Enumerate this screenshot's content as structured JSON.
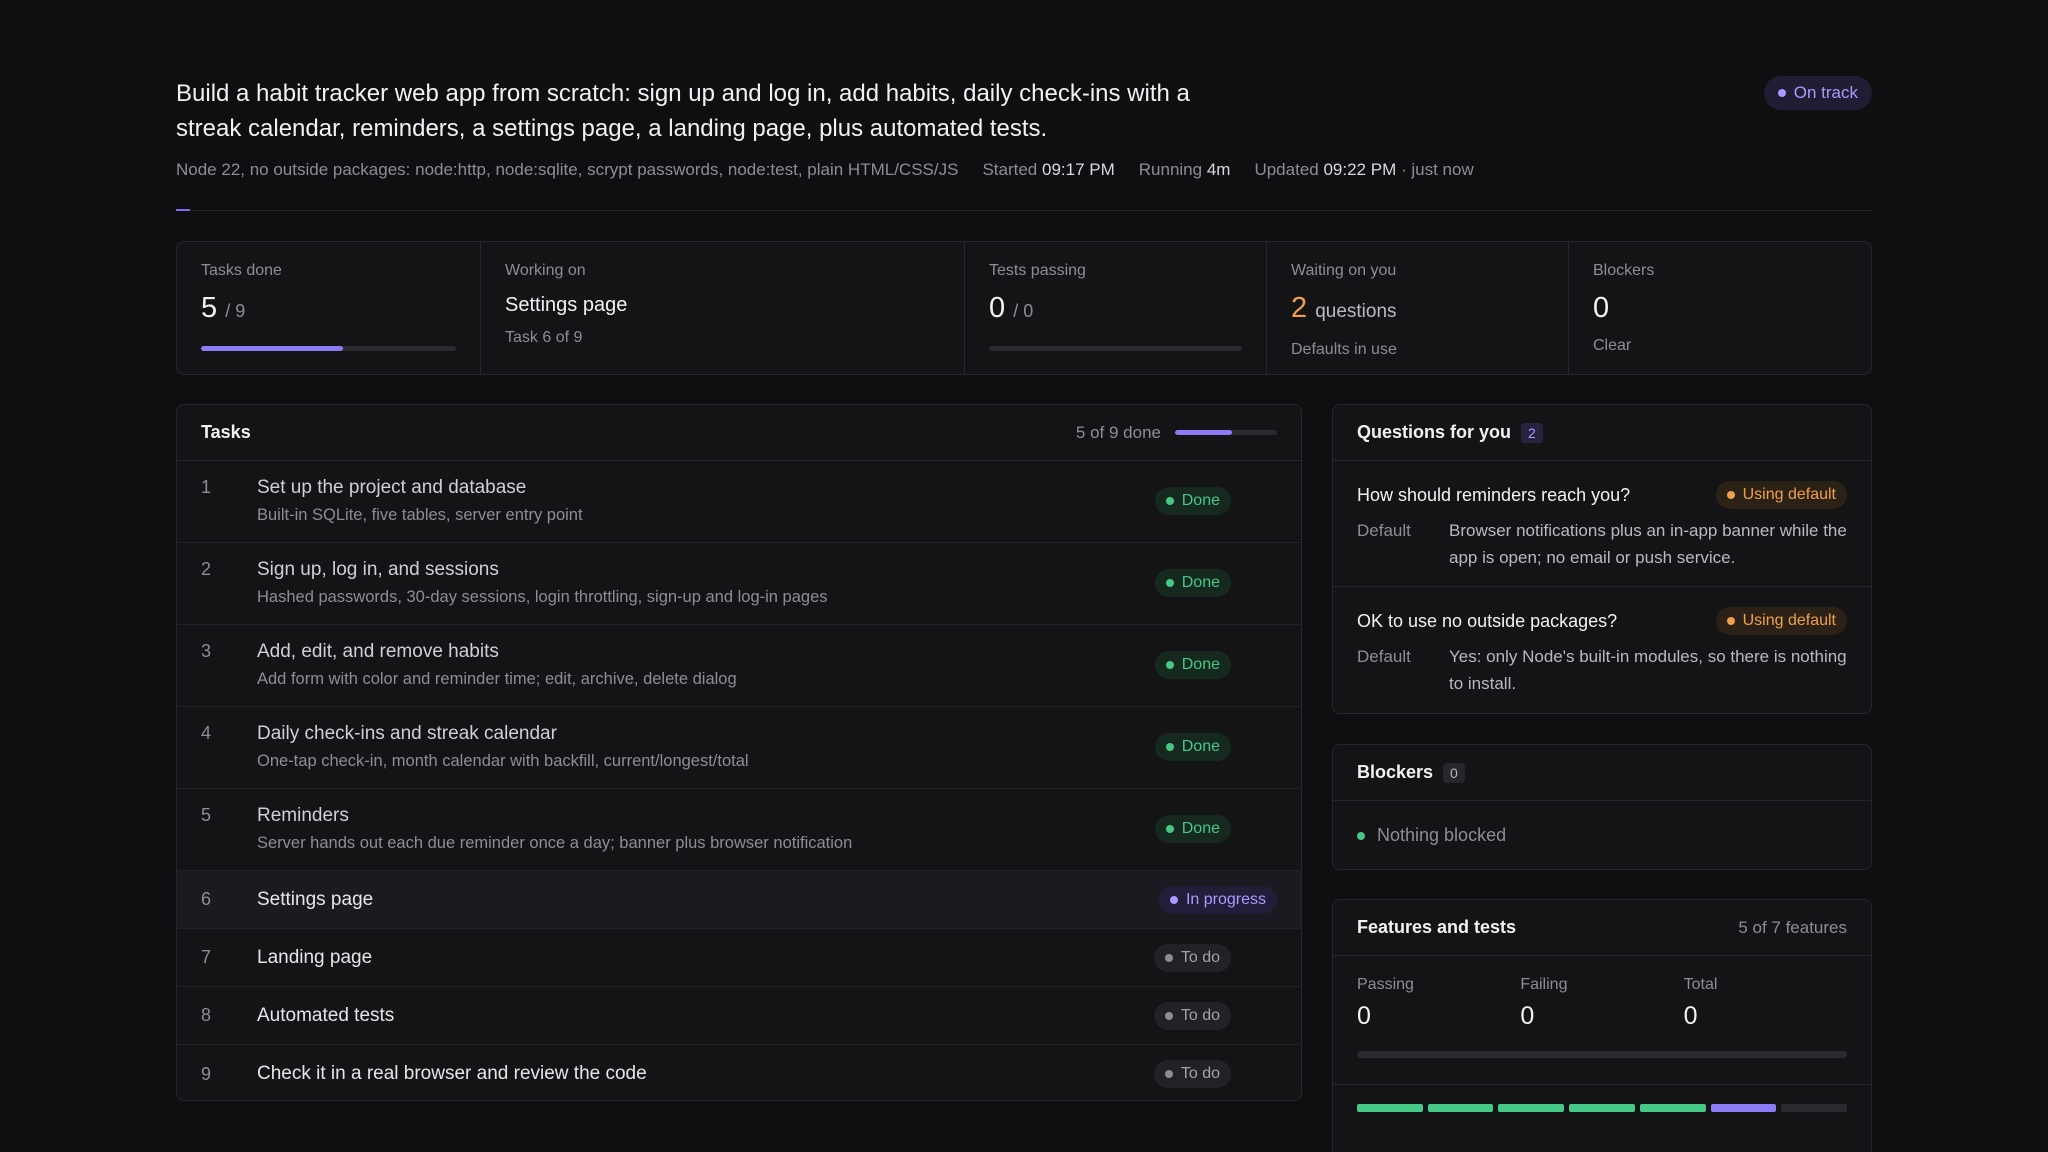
{
  "header": {
    "title": "Build a habit tracker web app from scratch: sign up and log in, add habits, daily check-ins with a streak calendar, reminders, a settings page, a landing page, plus automated tests.",
    "status": "On track",
    "status_color": "#a99bff",
    "stack": "Node 22, no outside packages: node:http, node:sqlite, scrypt passwords, node:test, plain HTML/CSS/JS",
    "started_label": "Started",
    "started_time": "09:17 PM",
    "running_label": "Running",
    "running_value": "4m",
    "updated_label": "Updated",
    "updated_time": "09:22 PM",
    "updated_suffix": "· just now"
  },
  "stats": {
    "tasks_done": {
      "label": "Tasks done",
      "value": "5",
      "total": "/ 9",
      "progress": 0.556
    },
    "working_on": {
      "label": "Working on",
      "title": "Settings page",
      "sub": "Task 6 of 9"
    },
    "tests_passing": {
      "label": "Tests passing",
      "value": "0",
      "total": "/ 0",
      "progress": 0
    },
    "waiting": {
      "label": "Waiting on you",
      "value": "2",
      "unit": "questions",
      "sub": "Defaults in use"
    },
    "blockers": {
      "label": "Blockers",
      "value": "0",
      "sub": "Clear"
    }
  },
  "tasks": {
    "title": "Tasks",
    "summary": "5 of 9 done",
    "progress": 0.556,
    "items": [
      {
        "num": "1",
        "name": "Set up the project and database",
        "desc": "Built-in SQLite, five tables, server entry point",
        "status": "Done"
      },
      {
        "num": "2",
        "name": "Sign up, log in, and sessions",
        "desc": "Hashed passwords, 30-day sessions, login throttling, sign-up and log-in pages",
        "status": "Done"
      },
      {
        "num": "3",
        "name": "Add, edit, and remove habits",
        "desc": "Add form with color and reminder time; edit, archive, delete dialog",
        "status": "Done"
      },
      {
        "num": "4",
        "name": "Daily check-ins and streak calendar",
        "desc": "One-tap check-in, month calendar with backfill, current/longest/total",
        "status": "Done"
      },
      {
        "num": "5",
        "name": "Reminders",
        "desc": "Server hands out each due reminder once a day; banner plus browser notification",
        "status": "Done"
      },
      {
        "num": "6",
        "name": "Settings page",
        "status": "In progress"
      },
      {
        "num": "7",
        "name": "Landing page",
        "status": "To do"
      },
      {
        "num": "8",
        "name": "Automated tests",
        "status": "To do"
      },
      {
        "num": "9",
        "name": "Check it in a real browser and review the code",
        "status": "To do"
      }
    ]
  },
  "questions": {
    "title": "Questions for you",
    "count": "2",
    "items": [
      {
        "question": "How should reminders reach you?",
        "badge": "Using default",
        "default_label": "Default",
        "default_text": "Browser notifications plus an in-app banner while the app is open; no email or push service."
      },
      {
        "question": "OK to use no outside packages?",
        "badge": "Using default",
        "default_label": "Default",
        "default_text": "Yes: only Node's built-in modules, so there is nothing to install."
      }
    ]
  },
  "blockers": {
    "title": "Blockers",
    "count": "0",
    "message": "Nothing blocked"
  },
  "features": {
    "title": "Features and tests",
    "summary": "5 of 7 features",
    "passing_label": "Passing",
    "passing": "0",
    "failing_label": "Failing",
    "failing": "0",
    "total_label": "Total",
    "total": "0",
    "segments": [
      "done",
      "done",
      "done",
      "done",
      "done",
      "in-progress",
      "todo"
    ]
  },
  "colors": {
    "accent": "#8a7cf5",
    "done": "#46c987",
    "warning": "#f0a04b",
    "todo": "#8d8d96"
  }
}
